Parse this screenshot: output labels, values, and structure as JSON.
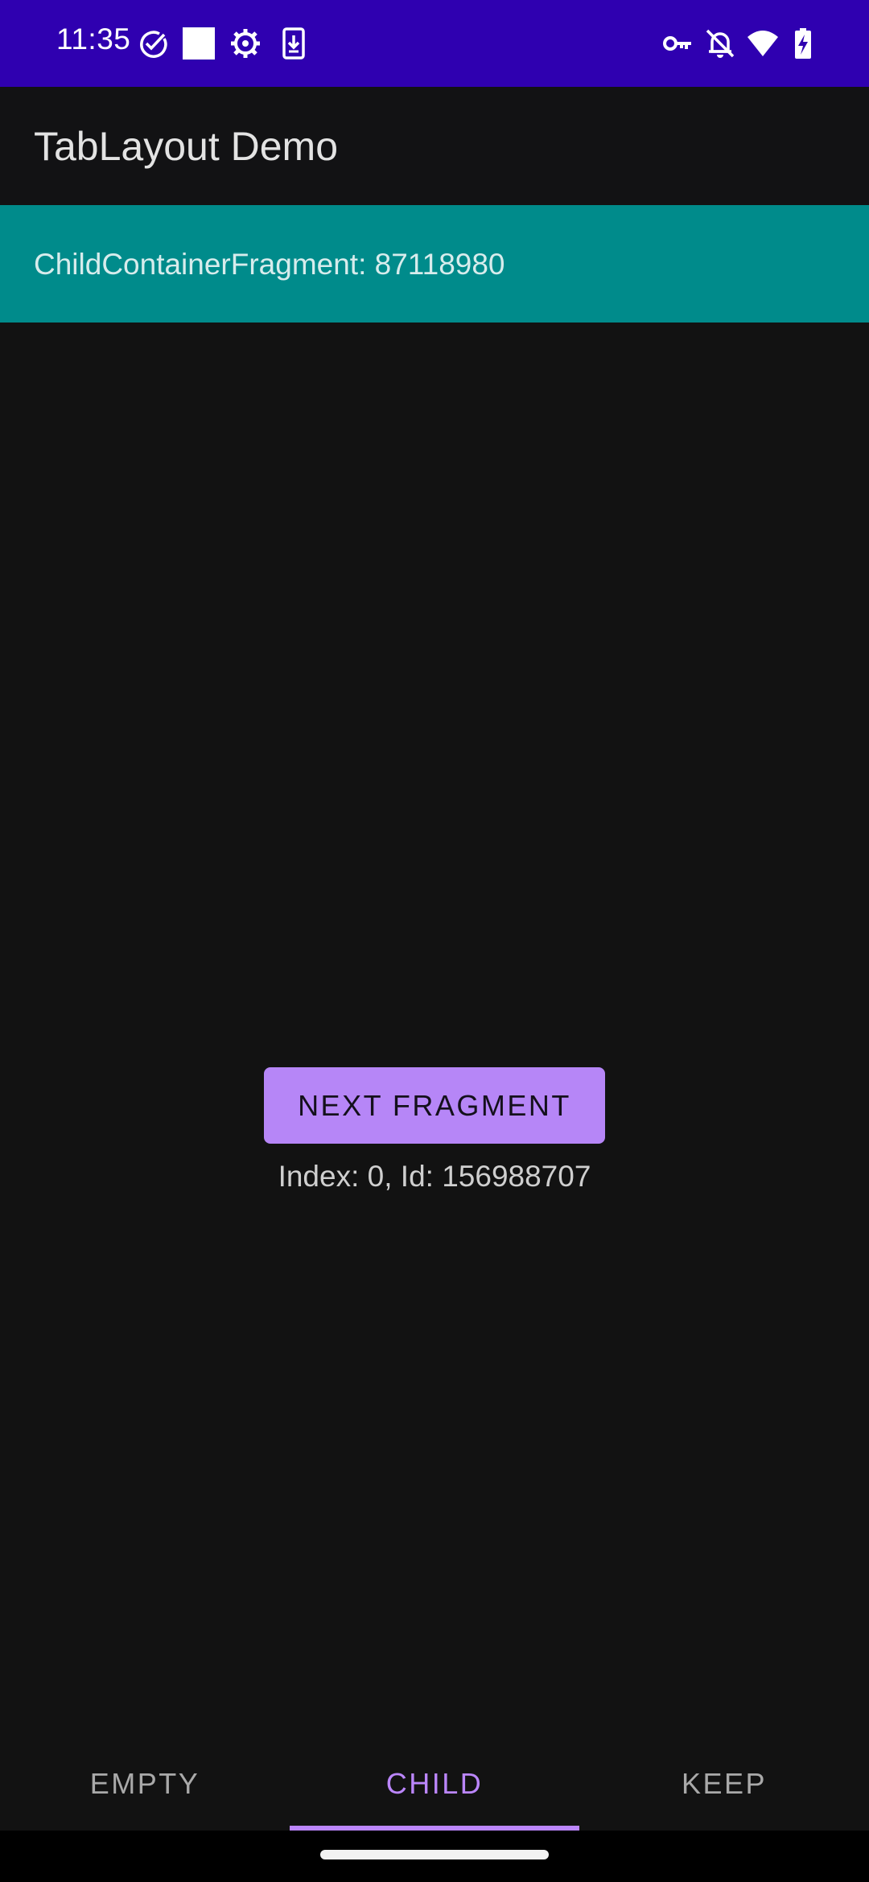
{
  "status_bar": {
    "time": "11:35",
    "icons_left": [
      "check-circle-icon",
      "white-square-icon",
      "gear-icon",
      "download-icon"
    ],
    "icons_right": [
      "key-icon",
      "bell-off-icon",
      "wifi-icon",
      "battery-charging-icon"
    ],
    "background": "#2f00b0"
  },
  "app_bar": {
    "title": "TabLayout Demo"
  },
  "banner": {
    "text": "ChildContainerFragment: 87118980",
    "background": "#008b8b"
  },
  "main": {
    "button_label": "NEXT FRAGMENT",
    "index_text": "Index: 0, Id: 156988707"
  },
  "tabs": [
    {
      "label": "EMPTY",
      "selected": false
    },
    {
      "label": "CHILD",
      "selected": true
    },
    {
      "label": "KEEP",
      "selected": false
    }
  ],
  "colors": {
    "accent": "#bb86fc",
    "background": "#121212"
  }
}
